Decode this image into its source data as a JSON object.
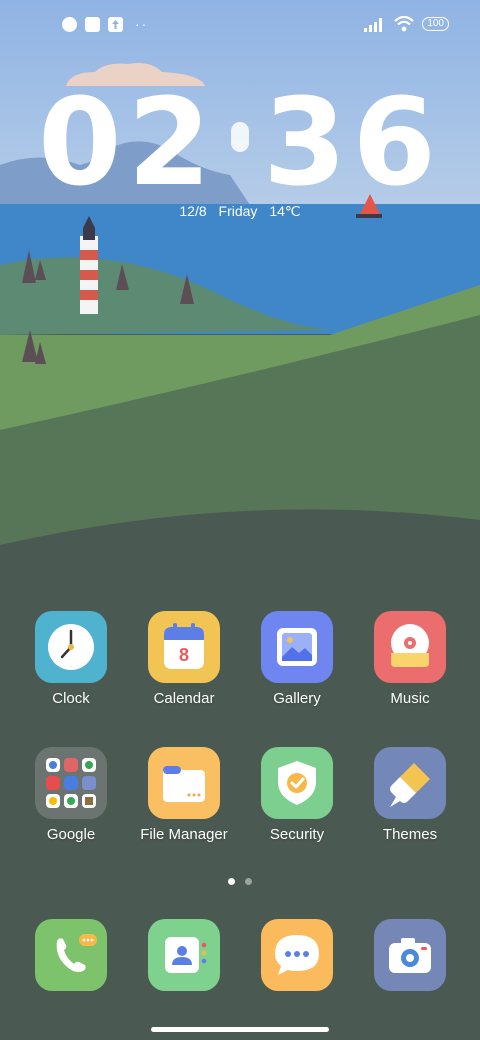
{
  "status_bar": {
    "left_icons": [
      "notification-app-icon",
      "square-notification-icon",
      "upload-icon"
    ],
    "more_dots": "··",
    "battery": "100",
    "signal_icon": "signal-bars-icon",
    "wifi_icon": "wifi-icon"
  },
  "clock": {
    "hours": "02",
    "minutes": "36",
    "date": "12/8",
    "weekday": "Friday",
    "temperature": "14℃"
  },
  "apps": [
    {
      "label": "Clock",
      "icon": "clock-icon",
      "color": "#4fb3cf"
    },
    {
      "label": "Calendar",
      "icon": "calendar-icon",
      "color": "#f2c453",
      "badge": "8"
    },
    {
      "label": "Gallery",
      "icon": "gallery-icon",
      "color": "#6f86f0"
    },
    {
      "label": "Music",
      "icon": "music-icon",
      "color": "#ec6d6e"
    },
    {
      "label": "Google",
      "icon": "google-folder-icon",
      "color": "#6b7470"
    },
    {
      "label": "File Manager",
      "icon": "folder-icon",
      "color": "#fbbf63"
    },
    {
      "label": "Security",
      "icon": "shield-check-icon",
      "color": "#7dcf90"
    },
    {
      "label": "Themes",
      "icon": "paintbrush-icon",
      "color": "#7388b8"
    }
  ],
  "dock": [
    {
      "icon": "phone-icon",
      "color": "#7dc36c"
    },
    {
      "icon": "contacts-icon",
      "color": "#7fd28e"
    },
    {
      "icon": "messages-icon",
      "color": "#fbbb5c"
    },
    {
      "icon": "camera-icon",
      "color": "#7487b6"
    }
  ],
  "pages": {
    "count": 2,
    "active": 1
  }
}
